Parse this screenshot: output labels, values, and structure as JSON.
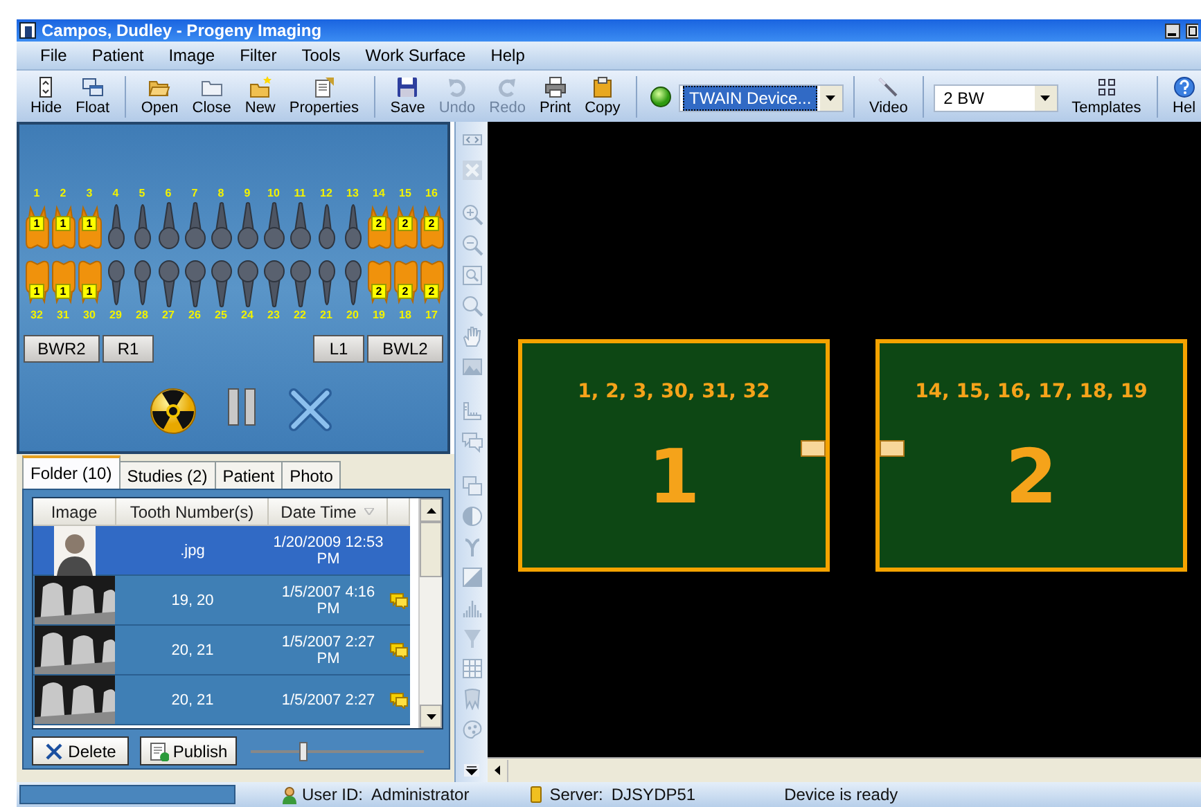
{
  "window": {
    "title": "Campos, Dudley - Progeny Imaging"
  },
  "menu": [
    "File",
    "Patient",
    "Image",
    "Filter",
    "Tools",
    "Work Surface",
    "Help"
  ],
  "toolbar": [
    {
      "kind": "button",
      "label": "Hide",
      "disabled": false
    },
    {
      "kind": "button",
      "label": "Float",
      "disabled": false
    },
    {
      "kind": "separator"
    },
    {
      "kind": "button",
      "label": "Open",
      "disabled": false
    },
    {
      "kind": "button",
      "label": "Close",
      "disabled": false
    },
    {
      "kind": "button",
      "label": "New",
      "disabled": false
    },
    {
      "kind": "button",
      "label": "Properties",
      "disabled": false
    },
    {
      "kind": "separator"
    },
    {
      "kind": "button",
      "label": "Save",
      "disabled": false
    },
    {
      "kind": "button",
      "label": "Undo",
      "disabled": true
    },
    {
      "kind": "button",
      "label": "Redo",
      "disabled": true
    },
    {
      "kind": "button",
      "label": "Print",
      "disabled": false
    },
    {
      "kind": "button",
      "label": "Copy",
      "disabled": false
    },
    {
      "kind": "separator"
    },
    {
      "kind": "indicator"
    },
    {
      "kind": "dropdown",
      "value": "TWAIN Device...",
      "selected": true
    },
    {
      "kind": "separator"
    },
    {
      "kind": "button",
      "label": "Video",
      "disabled": false
    },
    {
      "kind": "separator"
    },
    {
      "kind": "dropdown",
      "value": "2 BW",
      "selected": false
    },
    {
      "kind": "button",
      "label": "Templates",
      "disabled": false
    },
    {
      "kind": "separator"
    },
    {
      "kind": "button",
      "label": "Hel",
      "disabled": false
    }
  ],
  "tooth_chart": {
    "upper": [
      {
        "number": "1",
        "selected": true,
        "badge": "1"
      },
      {
        "number": "2",
        "selected": true,
        "badge": "1"
      },
      {
        "number": "3",
        "selected": true,
        "badge": "1"
      },
      {
        "number": "4",
        "selected": false
      },
      {
        "number": "5",
        "selected": false
      },
      {
        "number": "6",
        "selected": false
      },
      {
        "number": "7",
        "selected": false
      },
      {
        "number": "8",
        "selected": false
      },
      {
        "number": "9",
        "selected": false
      },
      {
        "number": "10",
        "selected": false
      },
      {
        "number": "11",
        "selected": false
      },
      {
        "number": "12",
        "selected": false
      },
      {
        "number": "13",
        "selected": false
      },
      {
        "number": "14",
        "selected": true,
        "badge": "2"
      },
      {
        "number": "15",
        "selected": true,
        "badge": "2"
      },
      {
        "number": "16",
        "selected": true,
        "badge": "2"
      }
    ],
    "lower": [
      {
        "number": "32",
        "selected": true,
        "badge": "1"
      },
      {
        "number": "31",
        "selected": true,
        "badge": "1"
      },
      {
        "number": "30",
        "selected": true,
        "badge": "1"
      },
      {
        "number": "29",
        "selected": false
      },
      {
        "number": "28",
        "selected": false
      },
      {
        "number": "27",
        "selected": false
      },
      {
        "number": "26",
        "selected": false
      },
      {
        "number": "25",
        "selected": false
      },
      {
        "number": "24",
        "selected": false
      },
      {
        "number": "23",
        "selected": false
      },
      {
        "number": "22",
        "selected": false
      },
      {
        "number": "21",
        "selected": false
      },
      {
        "number": "20",
        "selected": false
      },
      {
        "number": "19",
        "selected": true,
        "badge": "2"
      },
      {
        "number": "18",
        "selected": true,
        "badge": "2"
      },
      {
        "number": "17",
        "selected": true,
        "badge": "2"
      }
    ],
    "left_buttons": [
      "BWR2",
      "R1"
    ],
    "right_buttons": [
      "L1",
      "BWL2"
    ]
  },
  "tabs": [
    {
      "label": "Folder (10)",
      "selected": true
    },
    {
      "label": "Studies (2)",
      "selected": false
    },
    {
      "label": "Patient",
      "selected": false
    },
    {
      "label": "Photo",
      "selected": false
    }
  ],
  "table": {
    "columns": [
      "Image",
      "Tooth Number(s)",
      "Date Time"
    ],
    "rows": [
      {
        "kind": "photo",
        "teeth": ".jpg",
        "date": "1/20/2009 12:53 PM",
        "note": false,
        "selected": true
      },
      {
        "kind": "xray",
        "teeth": "19, 20",
        "date": "1/5/2007 4:16 PM",
        "note": true,
        "selected": false
      },
      {
        "kind": "xray",
        "teeth": "20, 21",
        "date": "1/5/2007 2:27 PM",
        "note": true,
        "selected": false
      },
      {
        "kind": "xray",
        "teeth": "20, 21",
        "date": "1/5/2007 2:27",
        "note": true,
        "selected": false
      }
    ]
  },
  "actions": [
    "Delete",
    "Publish"
  ],
  "slider": {
    "level": 0.3
  },
  "templates": [
    {
      "teeth": "1, 2, 3, 30, 31, 32",
      "number": "1"
    },
    {
      "teeth": "14, 15, 16, 17, 18, 19",
      "number": "2"
    }
  ],
  "status_bar": {
    "user_label": "User ID:",
    "user": "Administrator",
    "server_label": "Server:",
    "server": "DJSYDP51",
    "message": "Device is ready"
  }
}
